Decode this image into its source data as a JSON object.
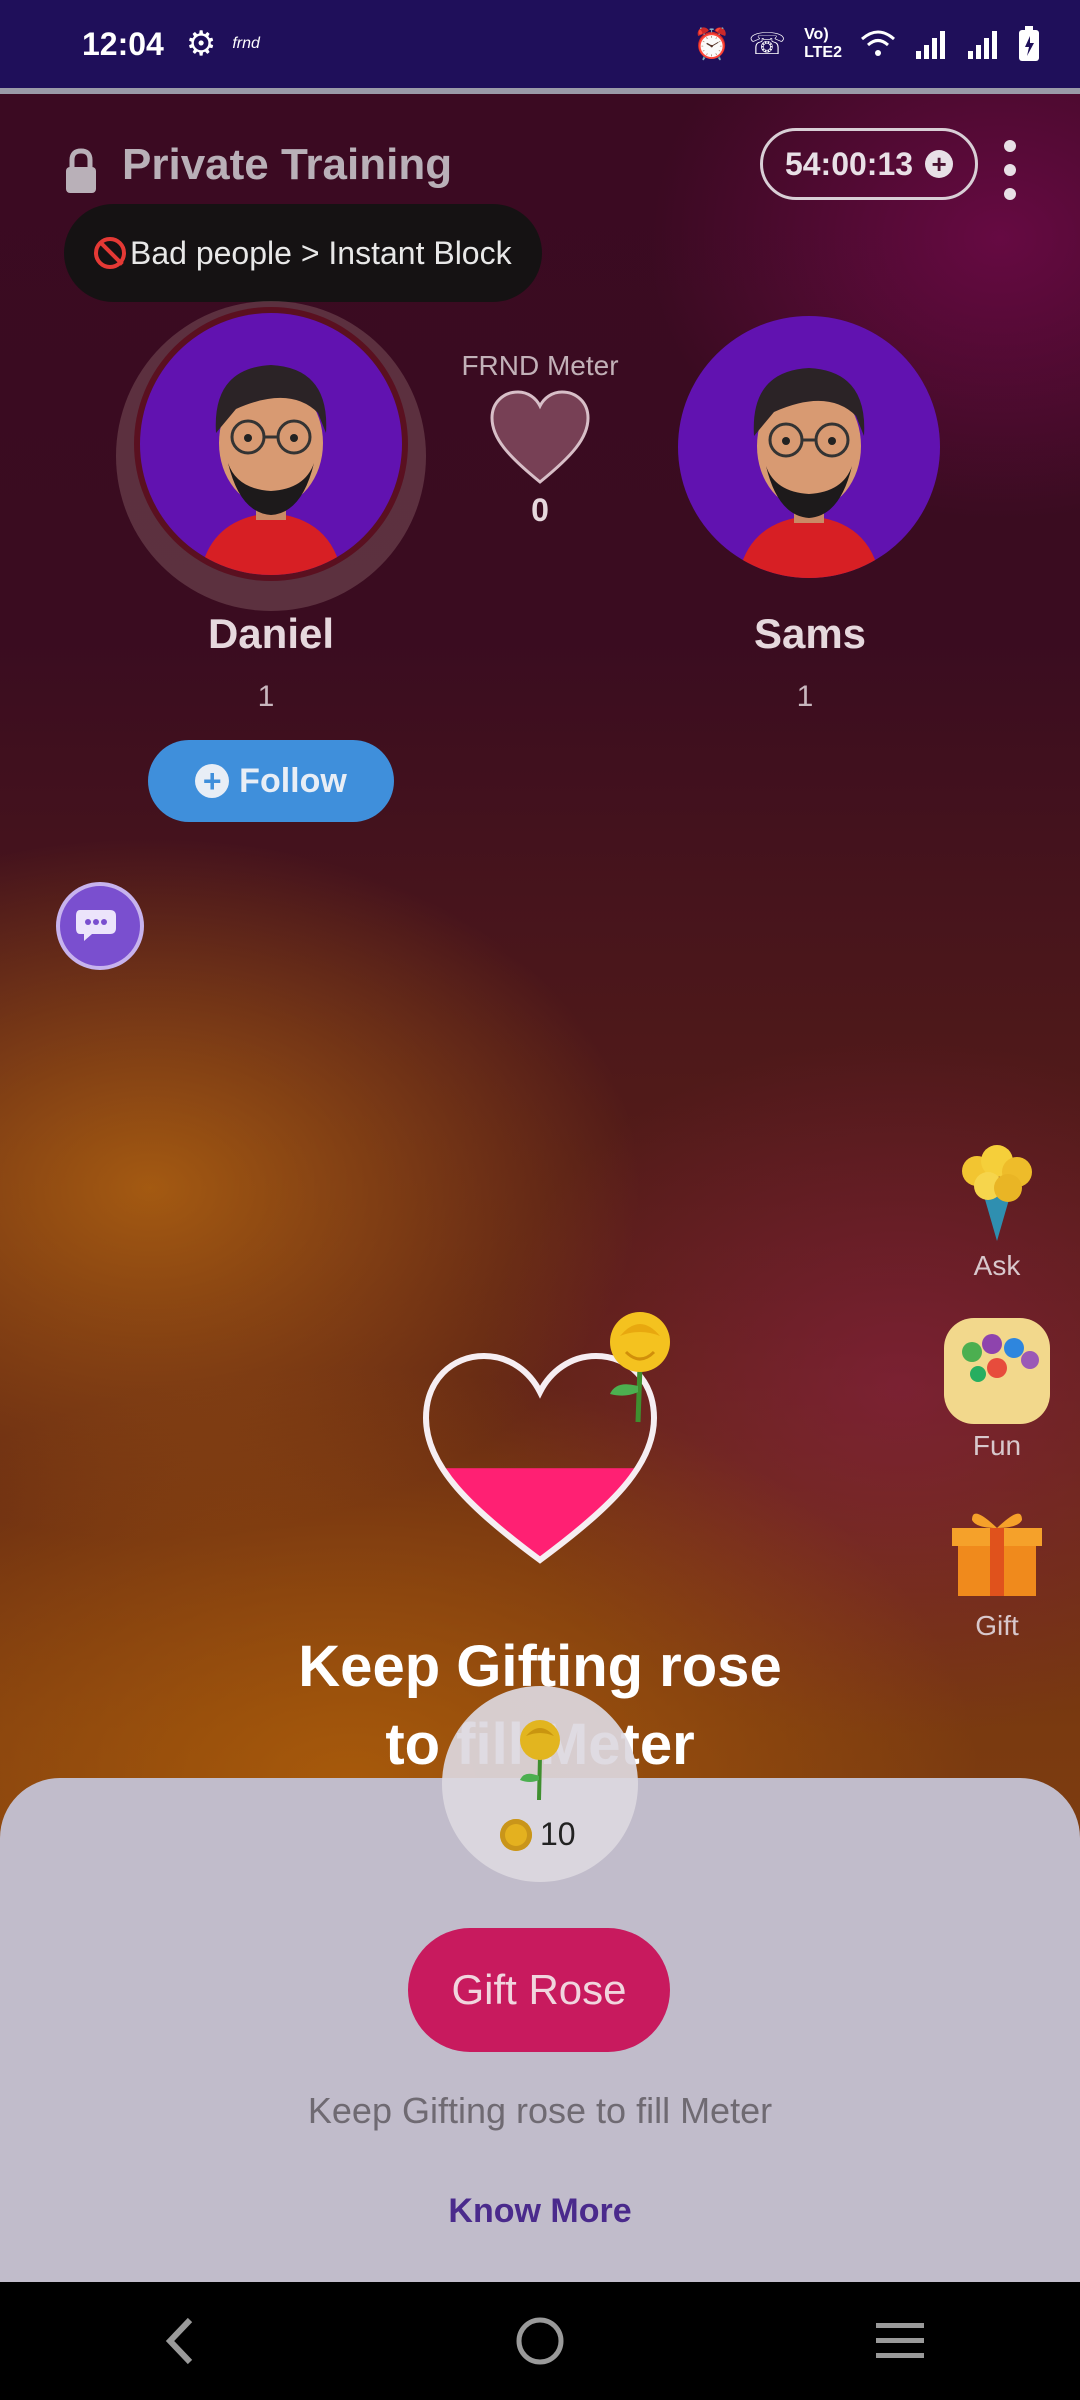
{
  "status_bar": {
    "time": "12:04",
    "app_mark": "frnd",
    "icons": [
      "gear-icon",
      "alarm-icon",
      "call-icon",
      "volte-icon",
      "wifi-icon",
      "signal-icon",
      "battery-icon"
    ]
  },
  "header": {
    "title": "Private Training",
    "timer": "54:00:13",
    "icons": [
      "lock-icon",
      "add-time-icon",
      "more-options-icon"
    ]
  },
  "toast": {
    "text": "Bad people > Instant Block",
    "icon": "block-icon"
  },
  "users": [
    {
      "name": "Daniel",
      "level": "1"
    },
    {
      "name": "Sams",
      "level": "1"
    }
  ],
  "meter": {
    "label": "FRND Meter",
    "count": "0"
  },
  "follow": {
    "label": "Follow"
  },
  "side_menu": [
    {
      "label": "Ask",
      "icon": "flower-bouquet-icon"
    },
    {
      "label": "Fun",
      "icon": "bubble-game-icon"
    },
    {
      "label": "Gift",
      "icon": "gift-box-icon"
    }
  ],
  "promo": {
    "line1": "Keep Gifting rose",
    "line2": "to fill Meter",
    "fill": 0.45
  },
  "sheet": {
    "price": "10",
    "button": "Gift Rose",
    "hint": "Keep Gifting rose to fill Meter",
    "link": "Know More"
  },
  "colors": {
    "status_bar": "#1f0f5a",
    "accent_pink": "#ff2073",
    "button": "#c81a5e",
    "follow": "#3f8fdb",
    "avatar_bg": "#6112b0",
    "link": "#4a2a8c"
  }
}
